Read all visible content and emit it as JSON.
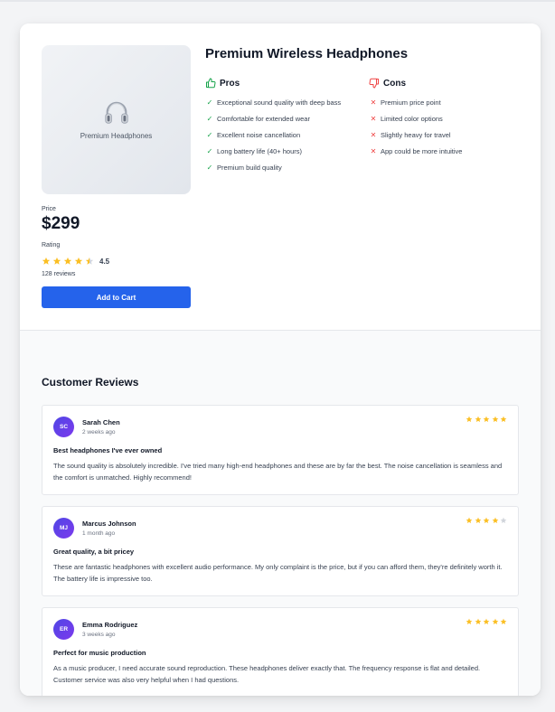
{
  "product": {
    "image_label": "Premium Headphones",
    "image_icon": "headphones-icon",
    "title": "Premium Wireless Headphones",
    "price_label": "Price",
    "price": "$299",
    "rating_label": "Rating",
    "rating_value": "4.5",
    "rating_stars": 4.5,
    "review_count": "128 reviews",
    "cart_button": "Add to Cart"
  },
  "pros": {
    "heading": "Pros",
    "icon": "thumbs-up-icon",
    "items": [
      "Exceptional sound quality with deep bass",
      "Comfortable for extended wear",
      "Excellent noise cancellation",
      "Long battery life (40+ hours)",
      "Premium build quality"
    ]
  },
  "cons": {
    "heading": "Cons",
    "icon": "thumbs-down-icon",
    "items": [
      "Premium price point",
      "Limited color options",
      "Slightly heavy for travel",
      "App could be more intuitive"
    ]
  },
  "reviews": {
    "heading": "Customer Reviews",
    "items": [
      {
        "initials": "SC",
        "name": "Sarah Chen",
        "date": "2 weeks ago",
        "stars": 5,
        "title": "Best headphones I've ever owned",
        "body": "The sound quality is absolutely incredible. I've tried many high-end headphones and these are by far the best. The noise cancellation is seamless and the comfort is unmatched. Highly recommend!"
      },
      {
        "initials": "MJ",
        "name": "Marcus Johnson",
        "date": "1 month ago",
        "stars": 4,
        "title": "Great quality, a bit pricey",
        "body": "These are fantastic headphones with excellent audio performance. My only complaint is the price, but if you can afford them, they're definitely worth it. The battery life is impressive too."
      },
      {
        "initials": "ER",
        "name": "Emma Rodriguez",
        "date": "3 weeks ago",
        "stars": 5,
        "title": "Perfect for music production",
        "body": "As a music producer, I need accurate sound reproduction. These headphones deliver exactly that. The frequency response is flat and detailed. Customer service was also very helpful when I had questions."
      }
    ]
  },
  "colors": {
    "accent": "#2563eb",
    "star_filled": "#fbbf24",
    "star_empty": "#d1d5db",
    "pro_check": "#16a34a",
    "con_x": "#ef4444",
    "avatar_gradient_start": "#4f46e5",
    "avatar_gradient_end": "#7c3aed"
  }
}
